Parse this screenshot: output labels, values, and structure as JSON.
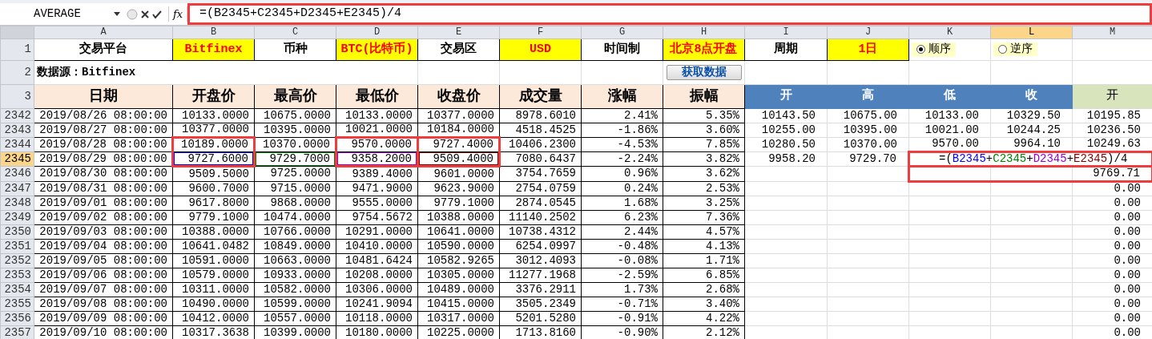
{
  "formula_bar": {
    "name_box": "AVERAGE",
    "function_label": "fx",
    "formula": "=(B2345+C2345+D2345+E2345)/4"
  },
  "columns": [
    {
      "label": "A",
      "selected": false
    },
    {
      "label": "B",
      "selected": false
    },
    {
      "label": "C",
      "selected": false
    },
    {
      "label": "D",
      "selected": false
    },
    {
      "label": "E",
      "selected": false
    },
    {
      "label": "F",
      "selected": false
    },
    {
      "label": "G",
      "selected": false
    },
    {
      "label": "H",
      "selected": false
    },
    {
      "label": "I",
      "selected": false
    },
    {
      "label": "J",
      "selected": false
    },
    {
      "label": "K",
      "selected": false
    },
    {
      "label": "L",
      "selected": true
    },
    {
      "label": "M",
      "selected": false
    }
  ],
  "settings_row": {
    "number": "1",
    "cells": [
      {
        "kind": "label",
        "text": "交易平台"
      },
      {
        "kind": "value",
        "text": "Bitfinex"
      },
      {
        "kind": "label",
        "text": "币种"
      },
      {
        "kind": "value",
        "text": "BTC(比特币)"
      },
      {
        "kind": "label",
        "text": "交易区"
      },
      {
        "kind": "value",
        "text": "USD"
      },
      {
        "kind": "label",
        "text": "时间制"
      },
      {
        "kind": "value",
        "text": "北京8点开盘"
      },
      {
        "kind": "label",
        "text": "周期"
      },
      {
        "kind": "value",
        "text": "1日"
      },
      {
        "kind": "radio",
        "text": "顺序",
        "selected": true
      },
      {
        "kind": "radio",
        "text": "逆序",
        "selected": false
      }
    ]
  },
  "source_row": {
    "number": "2",
    "text": "数据源：Bitfinex",
    "button": "获取数据"
  },
  "heading_row": {
    "number": "3",
    "cells": [
      {
        "kind": "main",
        "text": "日期"
      },
      {
        "kind": "main",
        "text": "开盘价"
      },
      {
        "kind": "main",
        "text": "最高价"
      },
      {
        "kind": "main",
        "text": "最低价"
      },
      {
        "kind": "main",
        "text": "收盘价"
      },
      {
        "kind": "main",
        "text": "成交量"
      },
      {
        "kind": "main",
        "text": "涨幅"
      },
      {
        "kind": "main",
        "text": "振幅"
      },
      {
        "kind": "blue",
        "text": "开"
      },
      {
        "kind": "blue",
        "text": "高"
      },
      {
        "kind": "blue",
        "text": "低"
      },
      {
        "kind": "blue",
        "text": "收"
      },
      {
        "kind": "green",
        "text": "开"
      }
    ]
  },
  "rows": [
    {
      "number": "2342",
      "selected": false,
      "cells": [
        "2019/08/26 08:00:00",
        "10133.0000",
        "10675.0000",
        "10133.0000",
        "10377.0000",
        "8978.6010",
        "2.41%",
        "5.35%"
      ],
      "calc": {
        "I": "10143.50",
        "J": "10675.00",
        "K": "10133.00",
        "L": "10329.50",
        "M": "10195.85"
      }
    },
    {
      "number": "2343",
      "selected": false,
      "cells": [
        "2019/08/27 08:00:00",
        "10377.0000",
        "10395.0000",
        "10021.0000",
        "10184.0000",
        "4518.4525",
        "-1.86%",
        "3.60%"
      ],
      "calc": {
        "I": "10255.00",
        "J": "10395.00",
        "K": "10021.00",
        "L": "10244.25",
        "M": "10236.50"
      }
    },
    {
      "number": "2344",
      "selected": false,
      "cells": [
        "2019/08/28 08:00:00",
        "10189.0000",
        "10370.0000",
        "9570.0000",
        "9727.4000",
        "10406.2300",
        "-4.53%",
        "7.85%"
      ],
      "calc": {
        "I": "10280.50",
        "J": "10370.00",
        "K": "9570.00",
        "L": "9964.10",
        "M": "10249.63"
      }
    },
    {
      "number": "2345",
      "selected": true,
      "cells": [
        {
          "text": "2019/08/29 08:00:00"
        },
        {
          "text": "9727.6000",
          "color": "#0000ff"
        },
        {
          "text": "9729.7000",
          "color": "#008000"
        },
        {
          "text": "9358.2000",
          "color": "#9900cc"
        },
        {
          "text": "9509.4000",
          "color": "#800000"
        },
        {
          "text": "7080.6437"
        },
        {
          "text": "-2.24%"
        },
        {
          "text": "3.82%"
        }
      ],
      "calc": {
        "I": "9958.20",
        "J": "9729.70"
      },
      "editing": [
        {
          "text": "=(",
          "color": "#000000"
        },
        {
          "text": "B2345",
          "color": "#0000ff"
        },
        {
          "text": "+",
          "color": "#000000"
        },
        {
          "text": "C2345",
          "color": "#008000"
        },
        {
          "text": "+",
          "color": "#000000"
        },
        {
          "text": "D2345",
          "color": "#9900cc"
        },
        {
          "text": "+",
          "color": "#000000"
        },
        {
          "text": "E2345",
          "color": "#800000"
        },
        {
          "text": ")/4",
          "color": "#000000"
        }
      ]
    },
    {
      "number": "2346",
      "selected": false,
      "cells": [
        "2019/08/30 08:00:00",
        "9509.5000",
        "9725.0000",
        "9389.4000",
        "9601.0000",
        "3754.7659",
        "0.96%",
        "3.62%"
      ],
      "calc": {
        "M": "9769.71"
      }
    },
    {
      "number": "2347",
      "selected": false,
      "cells": [
        "2019/08/31 08:00:00",
        "9600.7000",
        "9715.0000",
        "9471.9000",
        "9623.9000",
        "2754.0759",
        "0.24%",
        "2.53%"
      ],
      "calc": {
        "M": "0.00"
      }
    },
    {
      "number": "2348",
      "selected": false,
      "cells": [
        "2019/09/01 08:00:00",
        "9617.8000",
        "9868.0000",
        "9555.0000",
        "9779.1000",
        "2874.0545",
        "1.68%",
        "3.25%"
      ],
      "calc": {
        "M": "0.00"
      }
    },
    {
      "number": "2349",
      "selected": false,
      "cells": [
        "2019/09/02 08:00:00",
        "9779.1000",
        "10474.0000",
        "9754.5672",
        "10388.0000",
        "11140.2502",
        "6.23%",
        "7.36%"
      ],
      "calc": {
        "M": "0.00"
      }
    },
    {
      "number": "2350",
      "selected": false,
      "cells": [
        "2019/09/03 08:00:00",
        "10388.0000",
        "10766.0000",
        "10291.0000",
        "10641.0000",
        "10738.4312",
        "2.44%",
        "4.57%"
      ],
      "calc": {
        "M": "0.00"
      }
    },
    {
      "number": "2351",
      "selected": false,
      "cells": [
        "2019/09/04 08:00:00",
        "10641.0482",
        "10849.0000",
        "10410.0000",
        "10590.0000",
        "6254.0997",
        "-0.48%",
        "4.13%"
      ],
      "calc": {
        "M": "0.00"
      }
    },
    {
      "number": "2352",
      "selected": false,
      "cells": [
        "2019/09/05 08:00:00",
        "10591.0000",
        "10663.0000",
        "10481.6424",
        "10582.9265",
        "3012.4093",
        "-0.08%",
        "1.71%"
      ],
      "calc": {
        "M": "0.00"
      }
    },
    {
      "number": "2353",
      "selected": false,
      "cells": [
        "2019/09/06 08:00:00",
        "10579.0000",
        "10933.0000",
        "10208.0000",
        "10305.0000",
        "11277.1968",
        "-2.59%",
        "6.85%"
      ],
      "calc": {
        "M": "0.00"
      }
    },
    {
      "number": "2354",
      "selected": false,
      "cells": [
        "2019/09/07 08:00:00",
        "10311.0000",
        "10582.0000",
        "10306.0000",
        "10489.0000",
        "3376.2911",
        "1.73%",
        "2.68%"
      ],
      "calc": {
        "M": "0.00"
      }
    },
    {
      "number": "2355",
      "selected": false,
      "cells": [
        "2019/09/08 08:00:00",
        "10490.0000",
        "10599.0000",
        "10241.9094",
        "10415.0000",
        "3505.2349",
        "-0.71%",
        "3.40%"
      ],
      "calc": {
        "M": "0.00"
      }
    },
    {
      "number": "2356",
      "selected": false,
      "cells": [
        "2019/09/09 08:00:00",
        "10412.0000",
        "10557.0000",
        "10118.0000",
        "10317.0000",
        "5201.5280",
        "-0.91%",
        "4.22%"
      ],
      "calc": {
        "M": "0.00"
      }
    },
    {
      "number": "2357",
      "selected": false,
      "cells": [
        "2019/09/10 08:00:00",
        "10317.3638",
        "10399.0000",
        "10180.0000",
        "10225.0000",
        "1713.8160",
        "-0.90%",
        "2.12%"
      ],
      "calc": {
        "M": "0.00"
      }
    }
  ],
  "annotations": [
    {
      "kind": "formula"
    },
    {
      "kind": "open"
    },
    {
      "kind": "low"
    },
    {
      "kind": "close"
    },
    {
      "kind": "result"
    }
  ]
}
